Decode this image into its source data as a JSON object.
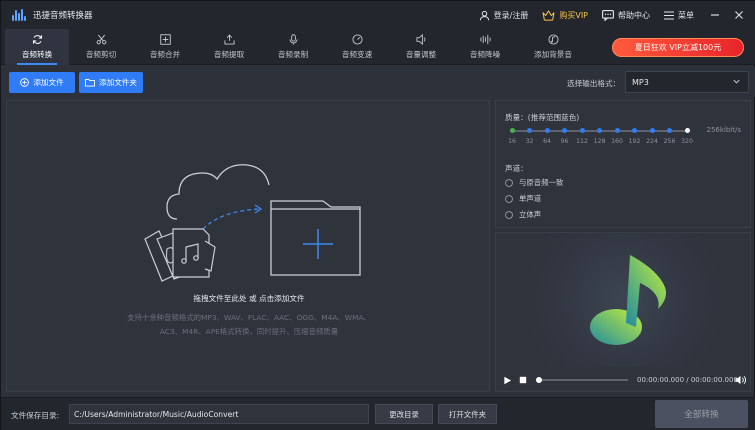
{
  "app": {
    "title": "迅捷音频转换器"
  },
  "titlebar": {
    "login": "登录/注册",
    "buy_vip": "购买VIP",
    "help": "帮助中心",
    "menu": "菜单"
  },
  "tabs": [
    {
      "label": "音频转换",
      "icon": "refresh-icon",
      "active": true
    },
    {
      "label": "音频剪切",
      "icon": "scissors-icon"
    },
    {
      "label": "音频合并",
      "icon": "merge-icon"
    },
    {
      "label": "音频提取",
      "icon": "extract-icon"
    },
    {
      "label": "音频录制",
      "icon": "microphone-icon"
    },
    {
      "label": "音频变速",
      "icon": "speed-icon"
    },
    {
      "label": "音量调整",
      "icon": "volume-icon"
    },
    {
      "label": "音频降噪",
      "icon": "noise-reduce-icon"
    },
    {
      "label": "添加背景音",
      "icon": "background-music-icon"
    }
  ],
  "promo": {
    "text": "夏日狂欢 VIP立减100元"
  },
  "toolbar": {
    "add_file": "添加文件",
    "add_folder": "添加文件夹",
    "format_label": "选择输出格式：",
    "format_value": "MP3"
  },
  "drop": {
    "title": "拖拽文件至此处 或 点击添加文件",
    "desc": "支持十余种音频格式的MP3、WAV、FLAC、AAC、OGG、M4A、WMA、AC3、M4R、APE格式转换，同时提升、压缩音频质量"
  },
  "settings": {
    "quality_label": "质量：(推荐范围蓝色)",
    "bitrates": [
      "16",
      "32",
      "64",
      "96",
      "112",
      "128",
      "160",
      "192",
      "224",
      "256",
      "320"
    ],
    "selected_bitrate": "256kibit/s",
    "channel_label": "声道：",
    "channels": [
      "与原音频一致",
      "单声道",
      "立体声"
    ]
  },
  "player": {
    "time": "00:00:00.000 / 00:00:00.000",
    "progress": 0
  },
  "footer": {
    "save_dir_label": "文件保存目录:",
    "save_path": "C:/Users/Administrator/Music/AudioConvert",
    "change_dir": "更改目录",
    "open_folder": "打开文件夹",
    "convert_all": "全部转换"
  },
  "colors": {
    "accent": "#2f7cf6",
    "promo": "#e8242a",
    "music_note": "#c5f03a"
  }
}
